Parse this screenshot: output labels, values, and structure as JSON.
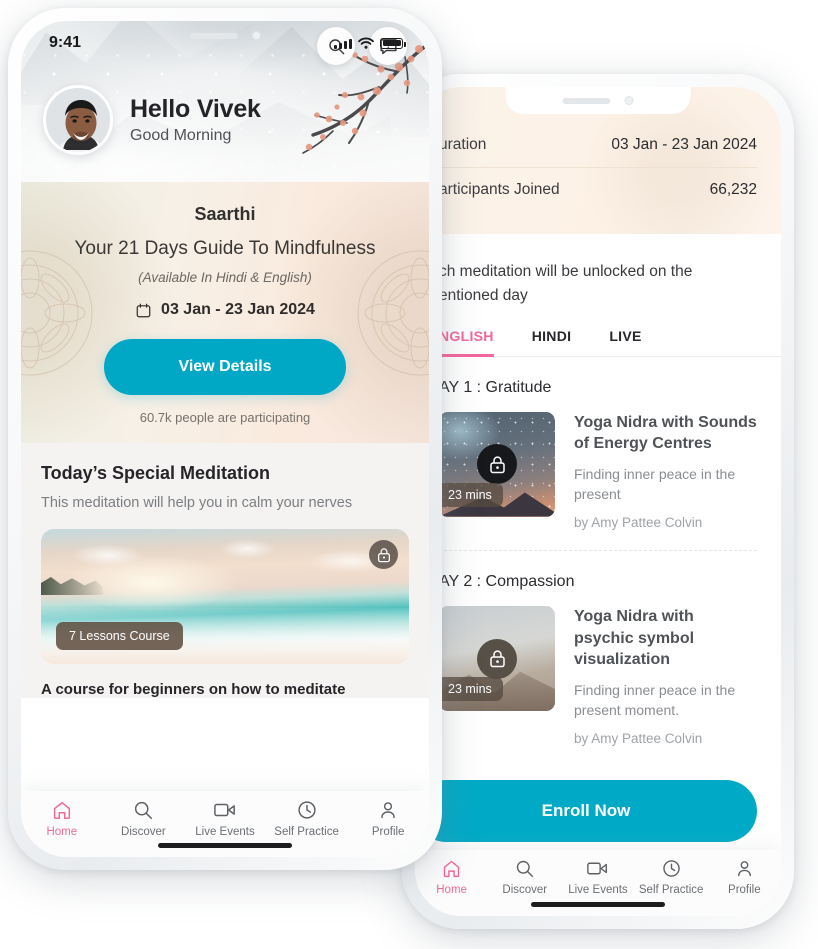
{
  "front_phone": {
    "statusbar": {
      "time": "9:41",
      "icons": [
        "signal-bars-icon",
        "wifi-icon",
        "battery-icon"
      ]
    },
    "hero": {
      "search_icon": "search-icon",
      "help_icon": "help-chat-icon",
      "help_glyph": "?",
      "greeting_name": "Hello Vivek",
      "greeting_sub": "Good Morning",
      "avatar": "user-avatar"
    },
    "saarthi_card": {
      "title": "Saarthi",
      "headline": "Your 21 Days Guide To Mindfulness",
      "availability": "(Available In Hindi & English)",
      "calendar_icon": "calendar-icon",
      "date_range": "03 Jan - 23 Jan 2024",
      "cta_label": "View Details",
      "participants": "60.7k people are participating"
    },
    "special": {
      "title": "Today’s Special Meditation",
      "subtitle": "This meditation will help you in calm your nerves",
      "lock_icon": "lock-icon",
      "lessons_badge": "7 Lessons Course",
      "footer": "A course for beginners on how to meditate"
    },
    "tabbar": [
      {
        "label": "Home",
        "icon": "home-icon",
        "active": true
      },
      {
        "label": "Discover",
        "icon": "search-icon",
        "active": false
      },
      {
        "label": "Live Events",
        "icon": "video-camera-icon",
        "active": false
      },
      {
        "label": "Self Practice",
        "icon": "clock-icon",
        "active": false
      },
      {
        "label": "Profile",
        "icon": "person-icon",
        "active": false
      }
    ]
  },
  "back_phone": {
    "info_rows": [
      {
        "key": "uration",
        "value": "03 Jan -  23 Jan 2024"
      },
      {
        "key": "articipants Joined",
        "value": "66,232"
      }
    ],
    "note": "ch meditation will be unlocked on the entioned day",
    "tabs": [
      {
        "label": "NGLISH",
        "active": true
      },
      {
        "label": "HINDI",
        "active": false
      },
      {
        "label": "LIVE",
        "active": false
      }
    ],
    "days": [
      {
        "heading": "AY 1 : Gratitude",
        "duration": "23 mins",
        "lock_icon": "lock-icon",
        "title": "Yoga Nidra with Sounds of Energy Centres",
        "description": "Finding inner peace in the present",
        "author": "by Amy Pattee Colvin",
        "thumb": "night-sky-thumbnail"
      },
      {
        "heading": "AY 2 : Compassion",
        "duration": "23 mins",
        "lock_icon": "lock-icon",
        "title": "Yoga Nidra with psychic symbol visualization",
        "description": "Finding inner peace in the present moment.",
        "author": "by Amy Pattee Colvin",
        "thumb": "mountain-thumbnail"
      }
    ],
    "enroll_label": "Enroll Now",
    "tabbar": [
      {
        "label": "Home",
        "icon": "home-icon",
        "active": true
      },
      {
        "label": "Discover",
        "icon": "search-icon",
        "active": false
      },
      {
        "label": "Live Events",
        "icon": "video-camera-icon",
        "active": false
      },
      {
        "label": "Self Practice",
        "icon": "clock-icon",
        "active": false
      },
      {
        "label": "Profile",
        "icon": "person-icon",
        "active": false
      }
    ]
  },
  "colors": {
    "brand_teal": "#00a8c6",
    "accent_pink": "#f4679a",
    "card_cream": "#f7e6dd",
    "text_dark": "#26262a"
  }
}
